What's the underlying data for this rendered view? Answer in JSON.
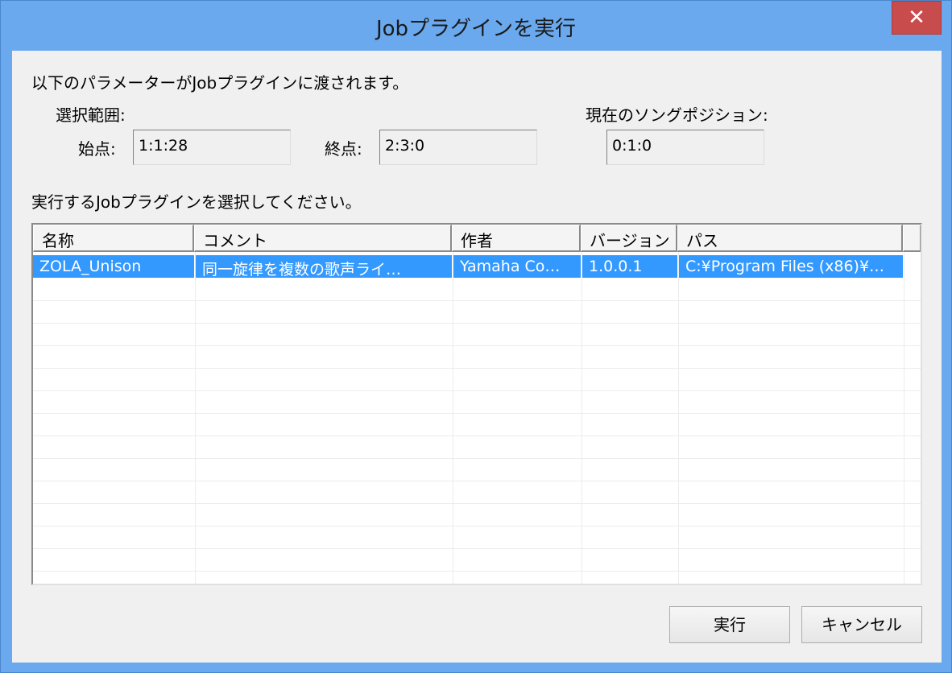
{
  "window": {
    "title": "Jobプラグインを実行",
    "close_glyph": "✕"
  },
  "params": {
    "intro": "以下のパラメーターがJobプラグインに渡されます。",
    "selection_label": "選択範囲:",
    "start_label": "始点:",
    "start_value": "1:1:28",
    "end_label": "終点:",
    "end_value": "2:3:0",
    "song_pos_label": "現在のソングポジション:",
    "song_pos_value": "0:1:0"
  },
  "plugins": {
    "instruction": "実行するJobプラグインを選択してください。",
    "columns": [
      "名称",
      "コメント",
      "作者",
      "バージョン",
      "パス"
    ],
    "rows": [
      {
        "name": "ZOLA_Unison",
        "comment": "同一旋律を複数の歌声ライ…",
        "author": "Yamaha Co…",
        "version": "1.0.0.1",
        "path": "C:¥Program Files (x86)¥…",
        "selected": true
      }
    ]
  },
  "buttons": {
    "run": "実行",
    "cancel": "キャンセル"
  },
  "colors": {
    "title_bar": "#6aa9ee",
    "close_button": "#c94c4c",
    "selection": "#3399ff"
  }
}
